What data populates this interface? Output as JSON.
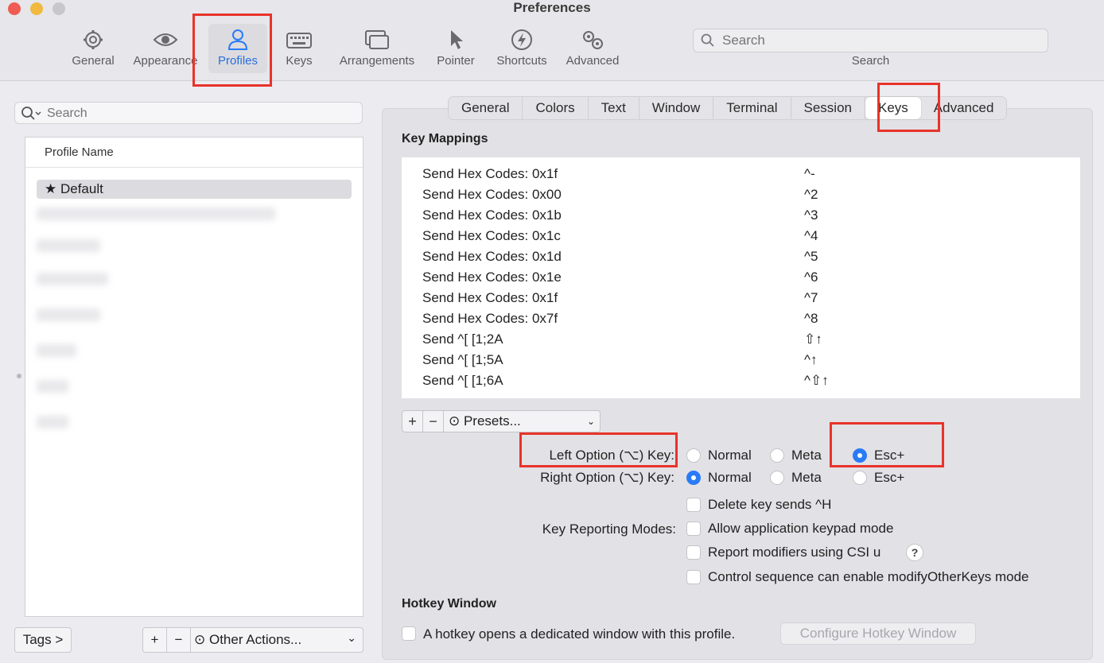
{
  "window": {
    "title": "Preferences"
  },
  "toolbar": {
    "items": [
      {
        "label": "General",
        "icon": "gear-icon"
      },
      {
        "label": "Appearance",
        "icon": "eye-icon"
      },
      {
        "label": "Profiles",
        "icon": "person-icon",
        "active": true
      },
      {
        "label": "Keys",
        "icon": "keyboard-icon"
      },
      {
        "label": "Arrangements",
        "icon": "windows-icon"
      },
      {
        "label": "Pointer",
        "icon": "pointer-icon"
      },
      {
        "label": "Shortcuts",
        "icon": "bolt-icon"
      },
      {
        "label": "Advanced",
        "icon": "gears-icon"
      }
    ],
    "search_placeholder": "Search",
    "search_label": "Search"
  },
  "left": {
    "search_placeholder": "Search",
    "column_header": "Profile Name",
    "selected_profile": "★ Default",
    "tags_label": "Tags >",
    "add_label": "+",
    "remove_label": "−",
    "other_actions_label": "⊙ Other Actions...",
    "chevron": "⌄"
  },
  "profile_tabs": {
    "items": [
      "General",
      "Colors",
      "Text",
      "Window",
      "Terminal",
      "Session",
      "Keys",
      "Advanced"
    ],
    "active": "Keys"
  },
  "key_mappings": {
    "title": "Key Mappings",
    "rows": [
      {
        "action": "Send Hex Codes: 0x1f",
        "key": "^-"
      },
      {
        "action": "Send Hex Codes: 0x00",
        "key": "^2"
      },
      {
        "action": "Send Hex Codes: 0x1b",
        "key": "^3"
      },
      {
        "action": "Send Hex Codes: 0x1c",
        "key": "^4"
      },
      {
        "action": "Send Hex Codes: 0x1d",
        "key": "^5"
      },
      {
        "action": "Send Hex Codes: 0x1e",
        "key": "^6"
      },
      {
        "action": "Send Hex Codes: 0x1f",
        "key": "^7"
      },
      {
        "action": "Send Hex Codes: 0x7f",
        "key": "^8"
      },
      {
        "action": "Send ^[ [1;2A",
        "key": "⇧↑"
      },
      {
        "action": "Send ^[ [1;5A",
        "key": "^↑"
      },
      {
        "action": "Send ^[ [1;6A",
        "key": "^⇧↑"
      }
    ],
    "add_label": "+",
    "remove_label": "−",
    "presets_label": "⊙ Presets...",
    "chevron": "⌄"
  },
  "options": {
    "left_option_label": "Left Option (⌥) Key:",
    "right_option_label": "Right Option (⌥) Key:",
    "choices": [
      "Normal",
      "Meta",
      "Esc+"
    ],
    "left_selected": "Esc+",
    "right_selected": "Normal",
    "delete_key": "Delete key sends ^H",
    "key_reporting_label": "Key Reporting Modes:",
    "keypad_mode": "Allow application keypad mode",
    "csi_u": "Report modifiers using CSI u",
    "help": "?",
    "modify_other_keys": "Control sequence can enable modifyOtherKeys mode"
  },
  "hotkey": {
    "title": "Hotkey Window",
    "checkbox_label": "A hotkey opens a dedicated window with this profile.",
    "configure_button": "Configure Hotkey Window"
  },
  "colors": {
    "accent": "#2a7bf6",
    "highlight_box": "#e8332a"
  }
}
